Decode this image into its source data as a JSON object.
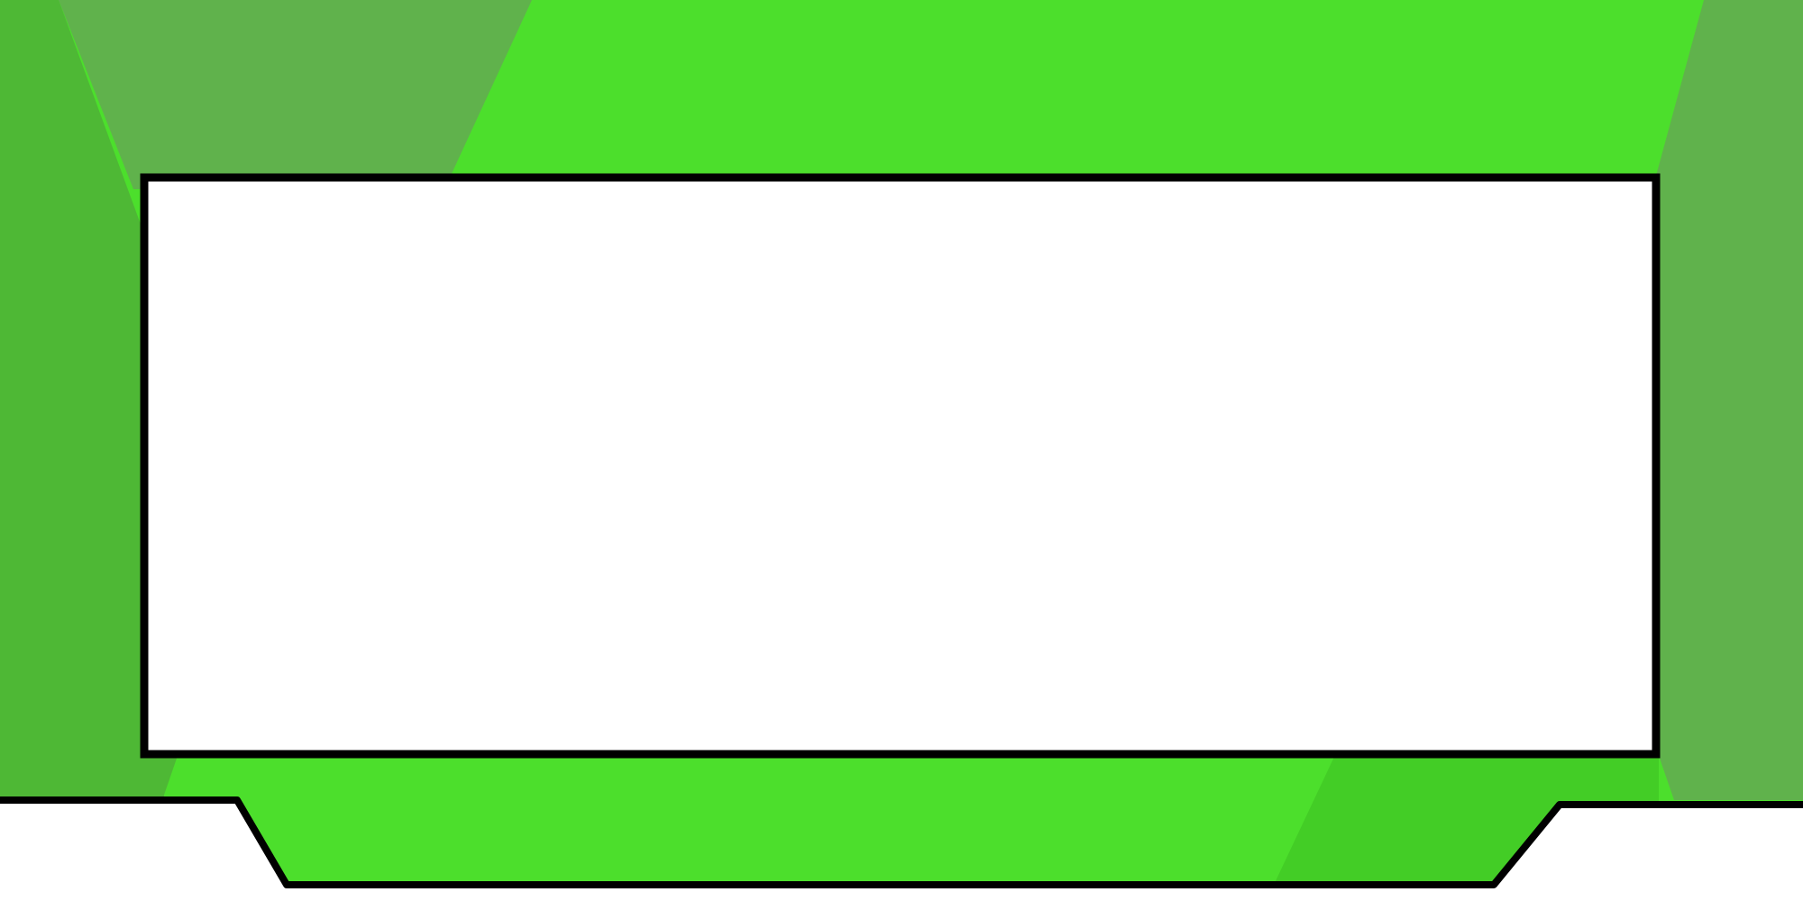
{
  "colors": {
    "background": "#ffffff",
    "green_main": "#4cdf2c",
    "green_light_muted": "#60b24c",
    "green_left_strip": "#4eb835",
    "green_dark_accent": "#43cd26",
    "panel_fill": "#ffffff",
    "outline": "#000000"
  },
  "content_panel": {
    "text": ""
  }
}
